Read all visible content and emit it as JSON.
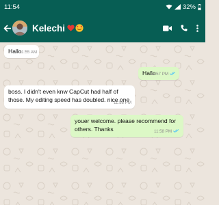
{
  "status_bar": {
    "time": "11:54",
    "battery": "32%"
  },
  "contact": {
    "name": "Kelechi"
  },
  "icons": [
    "back-arrow-icon",
    "avatar",
    "heart-emoji-icon",
    "smiling-face-emoji-icon",
    "video-call-icon",
    "phone-icon",
    "more-options-icon",
    "read-ticks-icon"
  ],
  "colors": {
    "header": "#075e54",
    "chat_background": "#ece5dd",
    "incoming_bubble": "#ffffff",
    "outgoing_bubble": "#dcf8c6",
    "read_ticks": "#4fc3f7"
  },
  "messages": [
    {
      "direction": "incoming",
      "text": "Hallo",
      "time": "11:55 AM"
    },
    {
      "direction": "outgoing",
      "text": "Hallo",
      "time": "11:57 PM",
      "status": "read"
    },
    {
      "direction": "incoming",
      "text": "boss. I didn't even knw CapCut had half of those. My editing speed has doubled. nice one",
      "time": "11:58 PM"
    },
    {
      "direction": "outgoing",
      "text": "youer welcome. please recommend for others. Thanks",
      "time": "11:58 PM",
      "status": "read"
    }
  ]
}
